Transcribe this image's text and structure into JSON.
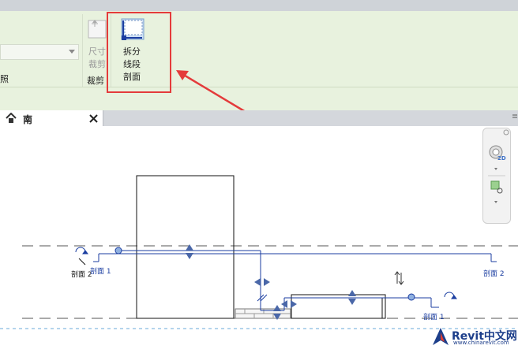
{
  "ribbon": {
    "left_panel_label": "照",
    "dimension_crop": {
      "label_line1": "尺寸",
      "label_line2": "裁剪"
    },
    "crop_panel_label": "裁剪",
    "split_segment": {
      "label_line1": "拆分",
      "label_line2": "线段"
    },
    "section_panel_label": "剖面"
  },
  "view_tab": {
    "title": "南"
  },
  "drawing": {
    "section2_left": "剖面 2",
    "section1_left": "剖面 1",
    "section2_right": "剖面 2",
    "section1_right": "剖面 1"
  },
  "watermark": {
    "brand": "Revit中文网",
    "url": "www.chinarevit.com"
  },
  "navbar": {
    "badge": "2D"
  },
  "colors": {
    "ribbon_bg": "#e8f2de",
    "highlight": "#e43b3b",
    "section_line": "#1b3ea1",
    "level_line": "#6aa8d8"
  }
}
